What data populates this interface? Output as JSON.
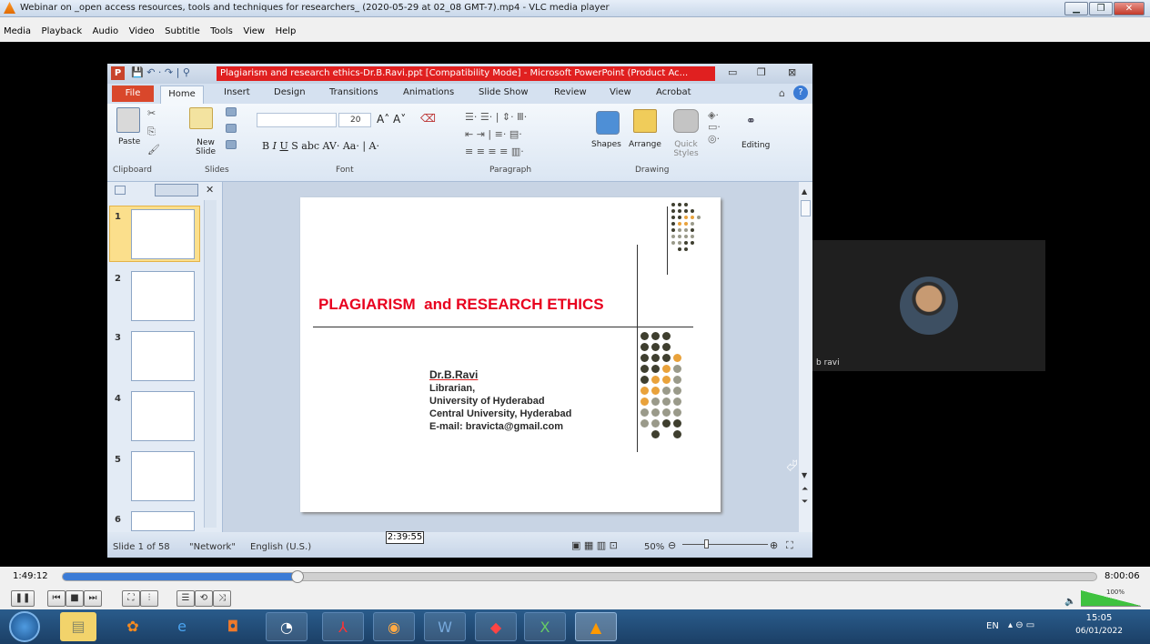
{
  "window": {
    "title": "Webinar on _open access resources, tools and techniques for researchers_ (2020-05-29 at 02_08 GMT-7).mp4 - VLC media player"
  },
  "menu": [
    "Media",
    "Playback",
    "Audio",
    "Video",
    "Subtitle",
    "Tools",
    "View",
    "Help"
  ],
  "ppt": {
    "title": "Plagiarism and research ethics-Dr.B.Ravi.ppt [Compatibility Mode] - Microsoft PowerPoint (Product Ac...",
    "tabs": [
      "File",
      "Home",
      "Insert",
      "Design",
      "Transitions",
      "Animations",
      "Slide Show",
      "Review",
      "View",
      "Acrobat"
    ],
    "groups": {
      "clipboard": "Clipboard",
      "slides": "Slides",
      "font": "Font",
      "paragraph": "Paragraph",
      "drawing": "Drawing"
    },
    "buttons": {
      "paste": "Paste",
      "new_slide": "New Slide",
      "font_size": "20",
      "shapes": "Shapes",
      "arrange": "Arrange",
      "quick_styles": "Quick Styles",
      "editing": "Editing"
    },
    "thumb_numbers": [
      "1",
      "2",
      "3",
      "4",
      "5",
      "6"
    ],
    "status": {
      "slide": "Slide 1 of 58",
      "theme": "\"Network\"",
      "lang": "English (U.S.)",
      "zoom": "50%"
    }
  },
  "slide": {
    "title": "PLAGIARISM  and RESEARCH ETHICS",
    "author": "Dr.B.Ravi",
    "lines": [
      "Librarian,",
      "University of Hyderabad",
      "Central University, Hyderabad",
      "E-mail: bravicta@gmail.com"
    ]
  },
  "webcam": {
    "name": "b ravi"
  },
  "player": {
    "elapsed": "1:49:12",
    "total": "8:00:06",
    "tooltip_time": "2:39:55",
    "volume": "100%",
    "progress": 0.227
  },
  "taskbar": {
    "lang": "EN",
    "time": "15:05",
    "date": "06/01/2022"
  },
  "colors": {
    "accent_red": "#e02020",
    "slide_title": "#e8001e",
    "dot_dark": "#3f3f2f",
    "dot_orange": "#e9a23b",
    "dot_gray": "#9a9a8a"
  }
}
